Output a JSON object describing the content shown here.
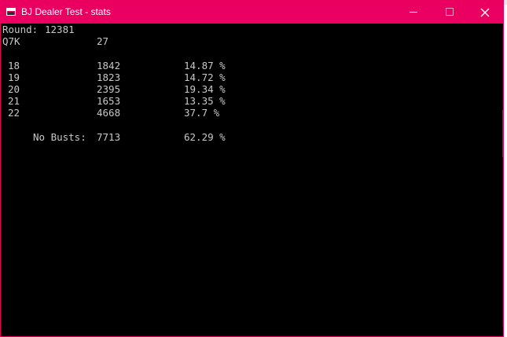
{
  "window": {
    "title": "BJ Dealer Test - stats",
    "accent_color": "#ea0061",
    "background_color": "#000000",
    "text_color": "#c8c8c8",
    "icons": {
      "app": "console-window-icon",
      "minimize": "minimize-icon",
      "maximize": "maximize-icon",
      "close": "close-icon"
    }
  },
  "console": {
    "round_label": "Round:",
    "round_value": "12381",
    "hand": "Q7K",
    "hand_total": "27",
    "rows": [
      {
        "total": "18",
        "count": "1842",
        "pct": "14.87 %"
      },
      {
        "total": "19",
        "count": "1823",
        "pct": "14.72 %"
      },
      {
        "total": "20",
        "count": "2395",
        "pct": "19.34 %"
      },
      {
        "total": "21",
        "count": "1653",
        "pct": "13.35 %"
      },
      {
        "total": "22",
        "count": "4668",
        "pct": "37.7 %"
      }
    ],
    "no_busts_label": "No Busts:",
    "no_busts_count": "7713",
    "no_busts_pct": "62.29 %"
  }
}
